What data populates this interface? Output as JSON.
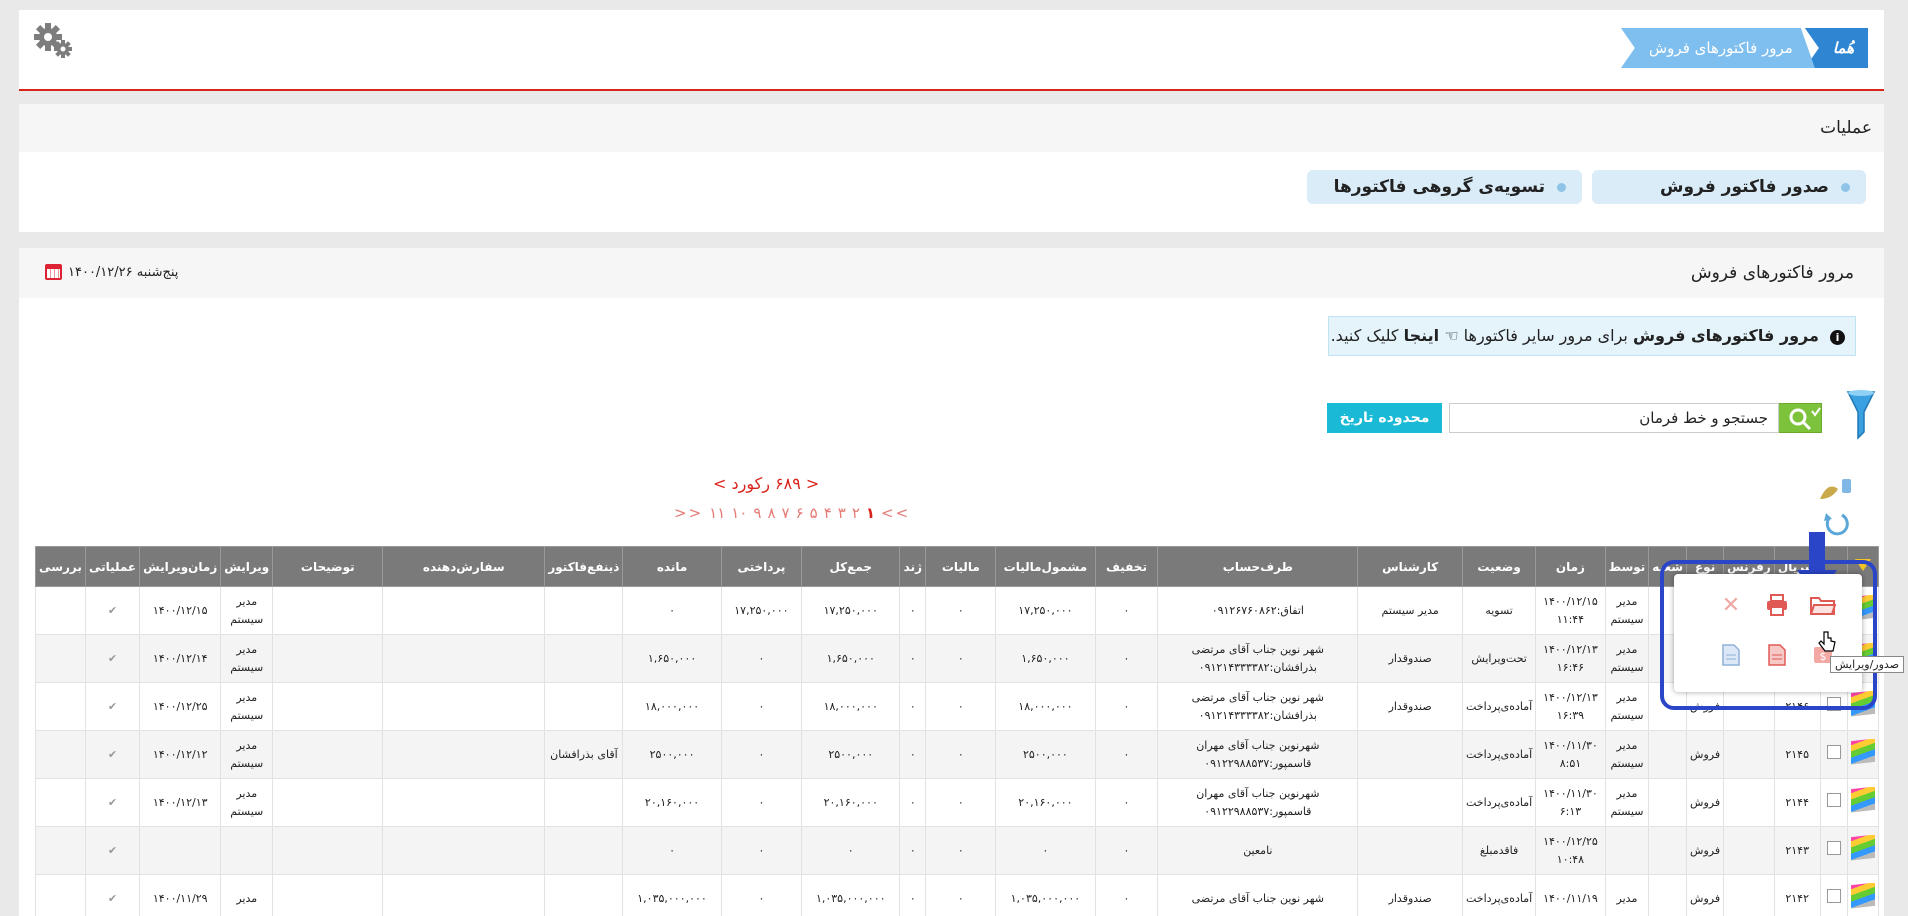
{
  "header": {
    "breadcrumb_home": "هُما",
    "breadcrumb_current": "مرور فاکتورهای فروش",
    "settings_icon": "gear-icon"
  },
  "operations": {
    "title": "عملیات",
    "issue_invoice": "صدور فاکتور فروش",
    "group_settle": "تسویه‌ی گروهی فاکتورها"
  },
  "panel": {
    "title": "مرور فاکتورهای فروش",
    "date": "پنج‌شنبه ۱۴۰۰/۱۲/۲۶",
    "info_bold": "مرور فاکتورهای فروش",
    "info_mid": "برای مرور سایر فاکتورها",
    "info_link": "اینجا",
    "info_end": "کلیک کنید.",
    "search_value": "جستجو و خط فرمان",
    "date_range_label": "محدوده تاریخ",
    "records": "<  ۶۸۹ رکورد  >",
    "pager_prev": ">>",
    "pager_next": "<<",
    "pages": [
      "۱",
      "۲",
      "۳",
      "۴",
      "۵",
      "۶",
      "۷",
      "۸",
      "۹",
      "۱۰",
      "۱۱"
    ]
  },
  "table": {
    "headers": [
      "",
      "",
      "سریال",
      "رفرنس",
      "نوع",
      "شعبه",
      "توسط",
      "زمان",
      "وضعیت",
      "کارشناس",
      "طرف‌حساب",
      "تخفیف",
      "مشمول‌مالیات",
      "مالیات",
      "ژند",
      "جمع‌کل",
      "پرداختی",
      "مانده",
      "ذینفع‌فاکتور",
      "سفارش‌دهنده",
      "توضیحات",
      "ویرایش",
      "زمان‌ویرایش",
      "عملیاتی",
      "بررسی"
    ],
    "rows": [
      {
        "serial": "",
        "ref": "",
        "type": "",
        "by": "مدیر سیستم",
        "time": "۱۴۰۰/۱۲/۱۵ ۱۱:۴۴",
        "status": "تسویه",
        "expert": "مدیر سیستم",
        "party": "اتفاق:۰۹۱۲۶۷۶۰۸۶۲",
        "discount": "۰",
        "taxable": "۱۷,۲۵۰,۰۰۰",
        "tax": "۰",
        "zhand": "۰",
        "total": "۱۷,۲۵۰,۰۰۰",
        "paid": "۱۷,۲۵۰,۰۰۰",
        "remain": "۰",
        "beneficiary": "",
        "orderer": "",
        "desc": "",
        "editor": "مدیر سیستم",
        "edit_time": "۱۴۰۰/۱۲/۱۵"
      },
      {
        "serial": "",
        "ref": "",
        "type": "",
        "by": "مدیر سیستم",
        "time": "۱۴۰۰/۱۲/۱۳ ۱۶:۴۶",
        "status": "تحت‌ویرایش",
        "expert": "صندوقدار",
        "party": "شهر نوین جناب آقای مرتضی بذرافشان:۰۹۱۲۱۴۳۳۳۳۸۲",
        "discount": "۰",
        "taxable": "۱,۶۵۰,۰۰۰",
        "tax": "۰",
        "zhand": "۰",
        "total": "۱,۶۵۰,۰۰۰",
        "paid": "۰",
        "remain": "۱,۶۵۰,۰۰۰",
        "beneficiary": "",
        "orderer": "",
        "desc": "",
        "editor": "مدیر سیستم",
        "edit_time": "۱۴۰۰/۱۲/۱۴"
      },
      {
        "serial": "۲۱۴۶",
        "ref": "",
        "type": "فروش",
        "by": "مدیر سیستم",
        "time": "۱۴۰۰/۱۲/۱۳ ۱۶:۳۹",
        "status": "آماده‌ی‌پرداخت",
        "expert": "صندوقدار",
        "party": "شهر نوین جناب آقای مرتضی بذرافشان:۰۹۱۲۱۴۳۳۳۳۸۲",
        "discount": "۰",
        "taxable": "۱۸,۰۰۰,۰۰۰",
        "tax": "۰",
        "zhand": "۰",
        "total": "۱۸,۰۰۰,۰۰۰",
        "paid": "۰",
        "remain": "۱۸,۰۰۰,۰۰۰",
        "beneficiary": "",
        "orderer": "",
        "desc": "",
        "editor": "مدیر سیستم",
        "edit_time": "۱۴۰۰/۱۲/۲۵"
      },
      {
        "serial": "۲۱۴۵",
        "ref": "",
        "type": "فروش",
        "by": "مدیر سیستم",
        "time": "۱۴۰۰/۱۱/۳۰ ۸:۵۱",
        "status": "آماده‌ی‌پرداخت",
        "expert": "",
        "party": "شهرنوین جناب آقای مهران قاسمپور:۰۹۱۲۲۹۸۸۵۳۷",
        "discount": "۰",
        "taxable": "۲۵۰۰,۰۰۰",
        "tax": "۰",
        "zhand": "۰",
        "total": "۲۵۰۰,۰۰۰",
        "paid": "۰",
        "remain": "۲۵۰۰,۰۰۰",
        "beneficiary": "آقای بذرافشان",
        "orderer": "",
        "desc": "",
        "editor": "مدیر سیستم",
        "edit_time": "۱۴۰۰/۱۲/۱۲"
      },
      {
        "serial": "۲۱۴۴",
        "ref": "",
        "type": "فروش",
        "by": "مدیر سیستم",
        "time": "۱۴۰۰/۱۱/۳۰ ۶:۱۳",
        "status": "آماده‌ی‌پرداخت",
        "expert": "",
        "party": "شهرنوین جناب آقای مهران قاسمپور:۰۹۱۲۲۹۸۸۵۳۷",
        "discount": "۰",
        "taxable": "۲۰,۱۶۰,۰۰۰",
        "tax": "۰",
        "zhand": "۰",
        "total": "۲۰,۱۶۰,۰۰۰",
        "paid": "۰",
        "remain": "۲۰,۱۶۰,۰۰۰",
        "beneficiary": "",
        "orderer": "",
        "desc": "",
        "editor": "مدیر سیستم",
        "edit_time": "۱۴۰۰/۱۲/۱۳"
      },
      {
        "serial": "۲۱۴۳",
        "ref": "",
        "type": "فروش",
        "by": "",
        "time": "۱۴۰۰/۱۲/۲۵ ۱۰:۴۸",
        "status": "فاقدمبلغ",
        "expert": "",
        "party": "نامعین",
        "discount": "۰",
        "taxable": "۰",
        "tax": "۰",
        "zhand": "۰",
        "total": "۰",
        "paid": "۰",
        "remain": "۰",
        "beneficiary": "",
        "orderer": "",
        "desc": "",
        "editor": "",
        "edit_time": ""
      },
      {
        "serial": "۲۱۴۲",
        "ref": "",
        "type": "فروش",
        "by": "مدیر",
        "time": "۱۴۰۰/۱۱/۱۹",
        "status": "آماده‌ی‌پرداخت",
        "expert": "صندوقدار",
        "party": "شهر نوین جناب آقای مرتضی",
        "discount": "۰",
        "taxable": "۱,۰۳۵,۰۰۰,۰۰۰",
        "tax": "۰",
        "zhand": "۰",
        "total": "۱,۰۳۵,۰۰۰,۰۰۰",
        "paid": "۰",
        "remain": "۱,۰۳۵,۰۰۰,۰۰۰",
        "beneficiary": "",
        "orderer": "",
        "desc": "",
        "editor": "مدیر",
        "edit_time": "۱۴۰۰/۱۱/۲۹"
      }
    ]
  },
  "popup": {
    "tooltip": "صدور/ویرایش"
  },
  "colors": {
    "accent_red": "#d9241c",
    "breadcrumb_blue": "#2e86d3",
    "date_range_cyan": "#1ab9d6",
    "highlight_blue": "#2b45c9"
  }
}
